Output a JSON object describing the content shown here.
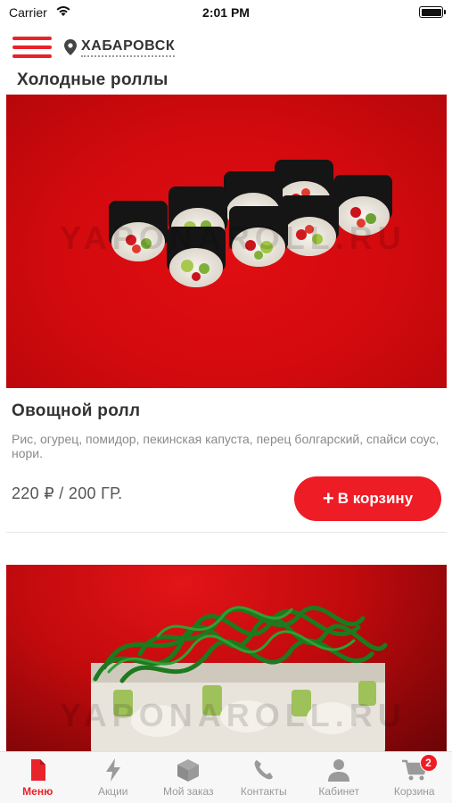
{
  "status_bar": {
    "carrier": "Carrier",
    "time": "2:01 PM"
  },
  "header": {
    "city": "ХАБАРОВСК",
    "menu_icon": "burger-icon",
    "location_icon": "pin-icon"
  },
  "section": {
    "title": "Холодные роллы"
  },
  "products": [
    {
      "name": "Овощной ролл",
      "description": "Рис, огурец, помидор, пекинская капуста, перец болгарский, спайси соус, нори.",
      "price": "220 ₽ / 200 ГР.",
      "add_button": "В корзину",
      "watermark": "YAPONAROLL.RU"
    },
    {
      "watermark": "YAPONAROLL.RU"
    }
  ],
  "tabs": [
    {
      "label": "Меню",
      "icon": "document-icon",
      "active": true
    },
    {
      "label": "Акции",
      "icon": "lightning-icon"
    },
    {
      "label": "Мой заказ",
      "icon": "box-icon"
    },
    {
      "label": "Контакты",
      "icon": "phone-icon"
    },
    {
      "label": "Кабинет",
      "icon": "user-icon"
    },
    {
      "label": "Корзина",
      "icon": "cart-icon",
      "badge": "2"
    }
  ],
  "colors": {
    "accent": "#ee1c25",
    "tab_inactive": "#999999",
    "text": "#333333"
  }
}
